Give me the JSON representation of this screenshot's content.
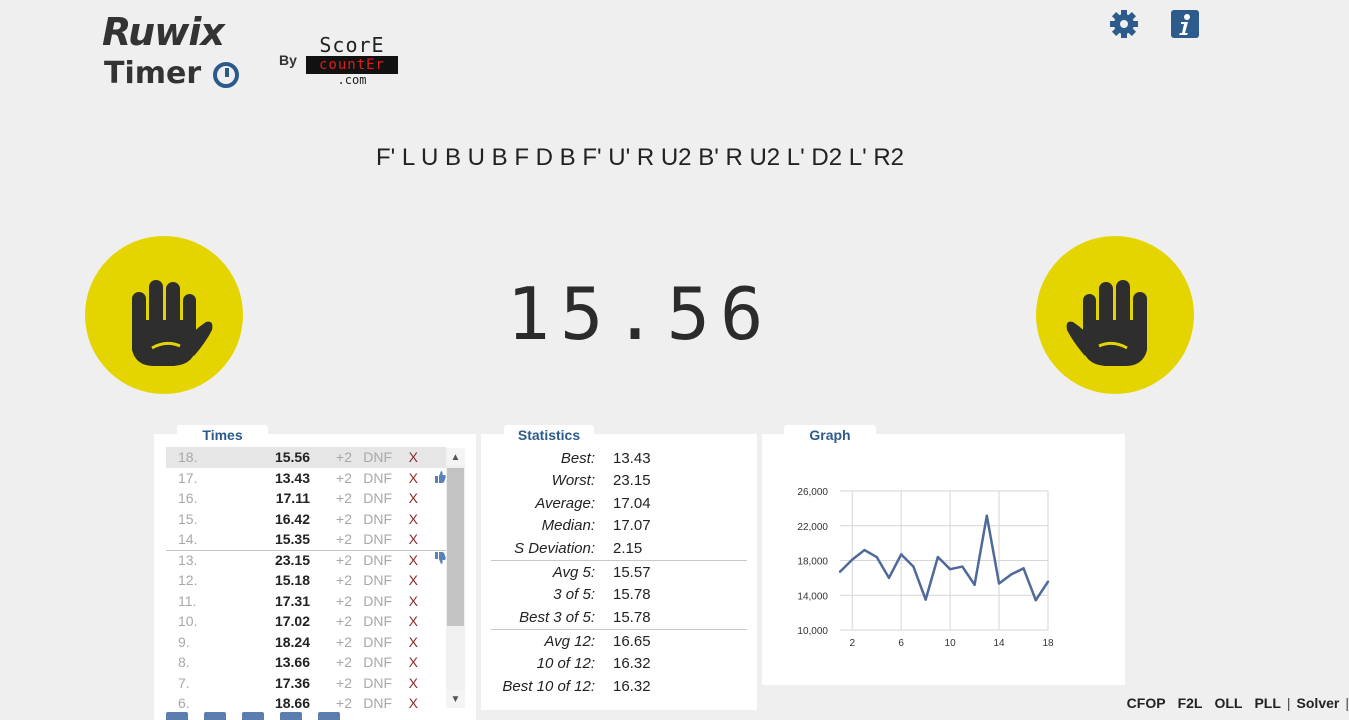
{
  "header": {
    "logo_line1": "Ruwix",
    "logo_line2": "Timer",
    "by": "By",
    "sponsor": {
      "line1": "ScorE",
      "line2": "countEr",
      "line3": ".com"
    },
    "icons": [
      "gear-icon",
      "info-icon"
    ]
  },
  "scramble": "F' L U B U B F D B F' U' R U2 B' R U2 L' D2 L' R2",
  "timer": "15.56",
  "colors": {
    "hand_circle": "#e4d500",
    "hand": "#2e2e2e",
    "accent": "#2c5b8c",
    "delete": "#8b2b2b"
  },
  "times_panel": {
    "title": "Times",
    "plus2": "+2",
    "dnf": "DNF",
    "delete": "X",
    "rows": [
      {
        "n": "18.",
        "t": "15.56",
        "thumb": ""
      },
      {
        "n": "17.",
        "t": "13.43",
        "thumb": "up"
      },
      {
        "n": "16.",
        "t": "17.11",
        "thumb": ""
      },
      {
        "n": "15.",
        "t": "16.42",
        "thumb": ""
      },
      {
        "n": "14.",
        "t": "15.35",
        "thumb": ""
      },
      {
        "n": "13.",
        "t": "23.15",
        "thumb": "down"
      },
      {
        "n": "12.",
        "t": "15.18",
        "thumb": ""
      },
      {
        "n": "11.",
        "t": "17.31",
        "thumb": ""
      },
      {
        "n": "10.",
        "t": "17.02",
        "thumb": ""
      },
      {
        "n": "9.",
        "t": "18.24",
        "thumb": ""
      },
      {
        "n": "8.",
        "t": "13.66",
        "thumb": ""
      },
      {
        "n": "7.",
        "t": "17.36",
        "thumb": ""
      },
      {
        "n": "6.",
        "t": "18.66",
        "thumb": ""
      }
    ]
  },
  "stats_panel": {
    "title": "Statistics",
    "rows": [
      {
        "k": "Best:",
        "v": "13.43"
      },
      {
        "k": "Worst:",
        "v": "23.15"
      },
      {
        "k": "Average:",
        "v": "17.04"
      },
      {
        "k": "Median:",
        "v": "17.07"
      },
      {
        "k": "S Deviation:",
        "v": "2.15"
      },
      {
        "k": "Avg 5:",
        "v": "15.57"
      },
      {
        "k": "3 of 5:",
        "v": "15.78"
      },
      {
        "k": "Best 3 of 5:",
        "v": "15.78"
      },
      {
        "k": "Avg 12:",
        "v": "16.65"
      },
      {
        "k": "10 of 12:",
        "v": "16.32"
      },
      {
        "k": "Best 10 of 12:",
        "v": "16.32"
      }
    ]
  },
  "graph_panel": {
    "title": "Graph"
  },
  "chart_data": {
    "type": "line",
    "x": [
      1,
      2,
      3,
      4,
      5,
      6,
      7,
      8,
      9,
      10,
      11,
      12,
      13,
      14,
      15,
      16,
      17,
      18
    ],
    "series": [
      {
        "values": [
          16700,
          18100,
          19200,
          18400,
          16000,
          18700,
          17300,
          13500,
          18400,
          17000,
          17300,
          15200,
          23150,
          15350,
          16400,
          17100,
          13430,
          15560
        ]
      }
    ],
    "xticks": [
      "2",
      "6",
      "10",
      "14",
      "18"
    ],
    "yticks": [
      "26,000",
      "22,000",
      "18,000",
      "14,000",
      "10,000"
    ],
    "xlim": [
      1,
      18
    ],
    "ylim": [
      10000,
      26000
    ],
    "grid": true,
    "line_color": "#4f6a9a"
  },
  "bottom_nav": [
    "CFOP",
    "F2L",
    "OLL",
    "PLL",
    "Solver"
  ]
}
